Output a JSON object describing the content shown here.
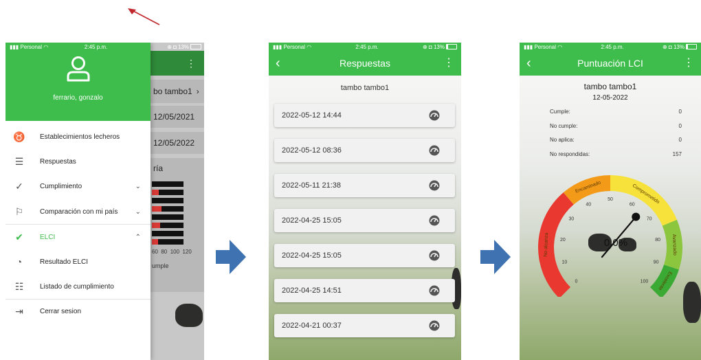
{
  "status_bar": {
    "carrier": "Personal",
    "time": "2:45 p.m.",
    "battery": "13%"
  },
  "drawer": {
    "user_name": "ferrario, gonzalo",
    "items": [
      {
        "label": "Establecimientos lecheros",
        "icon": "cow-icon"
      },
      {
        "label": "Respuestas",
        "icon": "list-check-icon"
      },
      {
        "label": "Cumplimiento",
        "icon": "double-check-icon",
        "chevron": "down"
      },
      {
        "label": "Comparación con mi país",
        "icon": "flag-icon",
        "chevron": "down"
      },
      {
        "label": "ELCI",
        "icon": "check-icon",
        "chevron": "up",
        "active": true
      },
      {
        "label": "Resultado ELCI",
        "icon": "gauge-icon"
      },
      {
        "label": "Listado de cumplimiento",
        "icon": "list-icon"
      },
      {
        "label": "Cerrar sesion",
        "icon": "logout-icon"
      }
    ],
    "background_screen": {
      "card1": "bo tambo1",
      "card2": "12/05/2021",
      "card3": "12/05/2022",
      "chart_title": "ría",
      "axis_ticks": "60  80  100  120",
      "legend": "umple"
    }
  },
  "respuestas": {
    "title": "Respuestas",
    "subtitle": "tambo tambo1",
    "items": [
      "2022-05-12 14:44",
      "2022-05-12 08:36",
      "2022-05-11 21:38",
      "2022-04-25 15:05",
      "2022-04-25 15:05",
      "2022-04-25 14:51",
      "2022-04-21 00:37"
    ]
  },
  "puntuacion": {
    "title": "Puntuación LCI",
    "farm": "tambo tambo1",
    "date": "12-05-2022",
    "stats": [
      {
        "label": "Cumple:",
        "value": "0"
      },
      {
        "label": "No cumple:",
        "value": "0"
      },
      {
        "label": "No aplica:",
        "value": "0"
      },
      {
        "label": "No respondidas:",
        "value": "157"
      }
    ],
    "gauge": {
      "value_text": "0.0%",
      "value": 0,
      "min": 0,
      "max": 100,
      "ticks": [
        "0",
        "10",
        "20",
        "30",
        "40",
        "50",
        "60",
        "70",
        "80",
        "90",
        "100"
      ],
      "bands": [
        {
          "label": "No alcanza",
          "from": 0,
          "to": 35,
          "color": "#e8382f"
        },
        {
          "label": "Encaminado",
          "from": 35,
          "to": 50,
          "color": "#f39a19"
        },
        {
          "label": "Comprometido",
          "from": 50,
          "to": 75,
          "color": "#f6e23a"
        },
        {
          "label": "Avanzado",
          "from": 75,
          "to": 90,
          "color": "#8cc63f"
        },
        {
          "label": "Excelente",
          "from": 90,
          "to": 100,
          "color": "#3aaa35"
        }
      ]
    }
  },
  "colors": {
    "brand_green": "#3ebd4c",
    "arrow_blue": "#3f72b0",
    "annotation_red": "#c0262c"
  }
}
